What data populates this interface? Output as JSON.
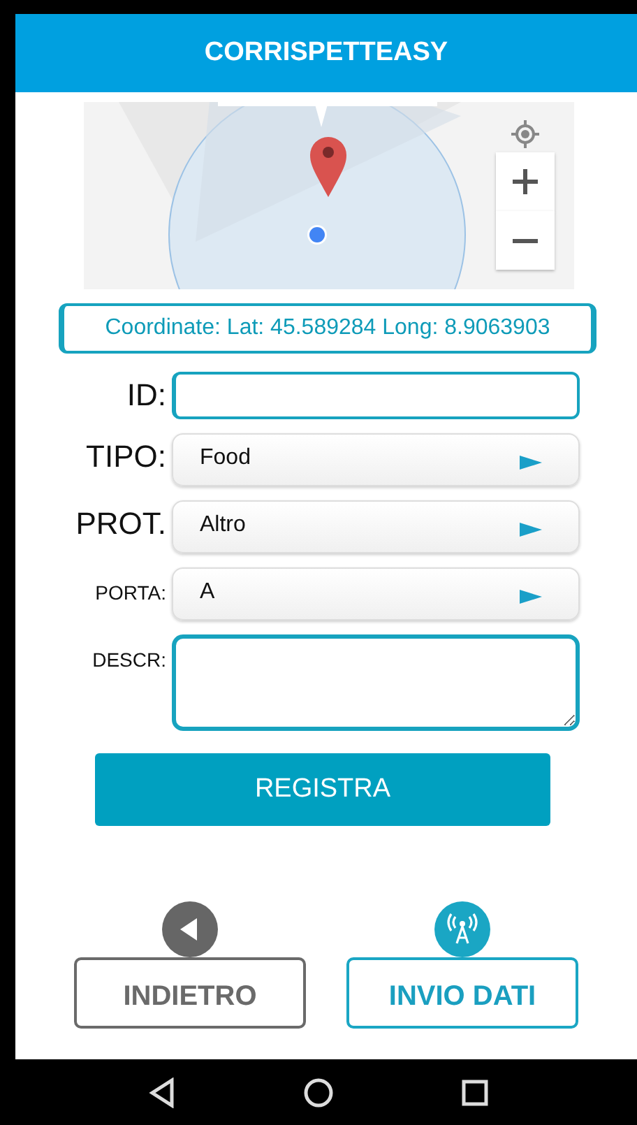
{
  "app_bar": {
    "title": "CORRISPETTEASY"
  },
  "coordinates": "Coordinate: Lat: 45.589284 Long: 8.9063903",
  "form": [
    {
      "label": "ID:",
      "kind": "input"
    },
    {
      "label": "TIPO:",
      "kind": "dropdown",
      "value": "Food"
    },
    {
      "label": "PROT.",
      "kind": "dropdown",
      "value": "Altro"
    },
    {
      "label": "PORTA:",
      "kind": "dropdown",
      "value": "A"
    },
    {
      "label": "DESCR:",
      "kind": "textarea"
    }
  ],
  "register_button": "REGISTRA",
  "actions": [
    {
      "label": "INDIETRO",
      "kind": "back"
    },
    {
      "label": "INVIO DATI",
      "kind": "send"
    }
  ]
}
